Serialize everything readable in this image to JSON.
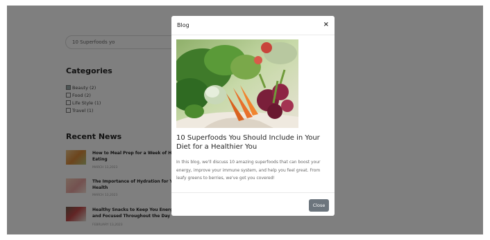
{
  "background": {
    "search": {
      "value": "10 Superfoods yo"
    },
    "categories": {
      "title": "Categories",
      "items": [
        {
          "label": "Beauty (2)",
          "checked": true
        },
        {
          "label": "Food (2)",
          "checked": false
        },
        {
          "label": "Life Style (1)",
          "checked": false
        },
        {
          "label": "Travel (1)",
          "checked": false
        }
      ]
    },
    "recent_news": {
      "title": "Recent News",
      "items": [
        {
          "title_line1": "How to Meal Prep for a Week of He",
          "title_line2": "Eating",
          "date": "MARCH 13,2023"
        },
        {
          "title_line1": "The Importance of Hydration for Yo",
          "title_line2": "Health",
          "date": "MARCH 13,2023"
        },
        {
          "title_line1": "Healthy Snacks to Keep You Energi",
          "title_line2": "and Focused Throughout the Day",
          "date": "FEBRUARY 13,2023"
        }
      ]
    }
  },
  "modal": {
    "title": "Blog",
    "close_icon": "×",
    "image_icon": "vegetable-basket-photo",
    "heading": "10 Superfoods You Should Include in Your Diet for a Healthier You",
    "body": "In this blog, we'll discuss 10 amazing superfoods that can boost your energy, improve your immune system, and help you feel great. From leafy greens to berries, we've got you covered!",
    "close_button": "Close"
  },
  "colors": {
    "overlay": "#000000",
    "button": "#6c757d"
  }
}
